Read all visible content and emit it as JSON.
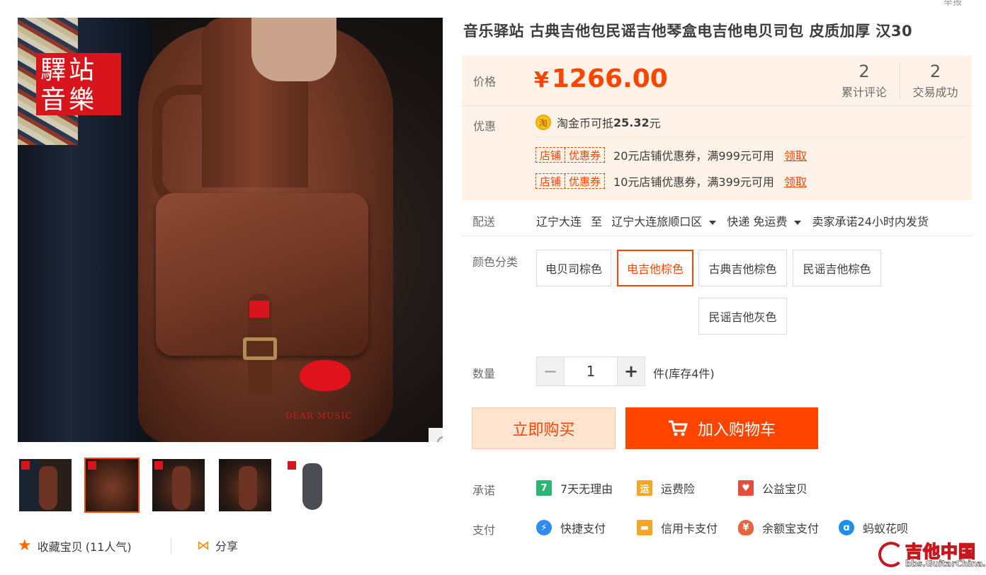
{
  "header": {
    "report_label": "举报"
  },
  "gallery": {
    "logo_text": "驛站 音樂",
    "watermark_text": "DEAR MUSIC",
    "zoom_icon": "search-icon",
    "thumbnails": [
      "电贝司棕色",
      "电吉他棕色",
      "古典吉他棕色",
      "民谣吉他棕色",
      "民谣吉他灰色"
    ],
    "active_thumbnail": 1
  },
  "favorite": {
    "label": "收藏宝贝",
    "count": "(11人气)"
  },
  "share": {
    "label": "分享"
  },
  "product": {
    "title": "音乐驿站 古典吉他包民谣吉他琴盒电吉他电贝司包 皮质加厚 汉30"
  },
  "price": {
    "label": "价格",
    "currency": "¥",
    "value": "1266.00",
    "reviews_count": "2",
    "reviews_label": "累计评论",
    "deals_count": "2",
    "deals_label": "交易成功"
  },
  "promo": {
    "label": "优惠",
    "coin_icon_text": "淘",
    "coin_prefix": "淘金币可抵",
    "coin_amount": "25.32",
    "coin_suffix": "元",
    "coupons": [
      {
        "tag_a": "店铺",
        "tag_b": "优惠券",
        "text": "20元店铺优惠券，满999元可用",
        "action": "领取"
      },
      {
        "tag_a": "店铺",
        "tag_b": "优惠券",
        "text": "10元店铺优惠券，满399元可用",
        "action": "领取"
      }
    ]
  },
  "shipping": {
    "label": "配送",
    "from": "辽宁大连",
    "to_word": "至",
    "to": "辽宁大连旅顺口区",
    "method": "快递 免运费",
    "promise": "卖家承诺24小时内发货"
  },
  "colors": {
    "label": "颜色分类",
    "options": [
      "电贝司棕色",
      "电吉他棕色",
      "古典吉他棕色",
      "民谣吉他棕色",
      "民谣吉他灰色"
    ],
    "selected": "电吉他棕色"
  },
  "quantity": {
    "label": "数量",
    "value": "1",
    "minus": "−",
    "plus": "+",
    "stock_text": "件(库存4件)"
  },
  "actions": {
    "buy_now": "立即购买",
    "add_to_cart": "加入购物车"
  },
  "promises": {
    "label": "承诺",
    "items": [
      {
        "icon": "seven-day-icon",
        "glyph": "7",
        "text": "7天无理由"
      },
      {
        "icon": "shipping-insurance-icon",
        "glyph": "运",
        "text": "运费险"
      },
      {
        "icon": "charity-icon",
        "glyph": "♥",
        "text": "公益宝贝"
      }
    ]
  },
  "payment": {
    "label": "支付",
    "items": [
      {
        "icon": "quick-pay-icon",
        "glyph": "⚡",
        "text": "快捷支付"
      },
      {
        "icon": "credit-card-icon",
        "glyph": "▬",
        "text": "信用卡支付"
      },
      {
        "icon": "yuebao-icon",
        "glyph": "¥",
        "text": "余额宝支付"
      },
      {
        "icon": "huabei-icon",
        "glyph": "ɑ",
        "text": "蚂蚁花呗"
      }
    ]
  },
  "site_watermark": {
    "title": "吉他中国",
    "url": "bbs.GuitarChina.com"
  },
  "colors_theme": {
    "accent": "#ff4400",
    "price_bg": "#fff2e8",
    "buy_bg": "#ffe4d0"
  }
}
